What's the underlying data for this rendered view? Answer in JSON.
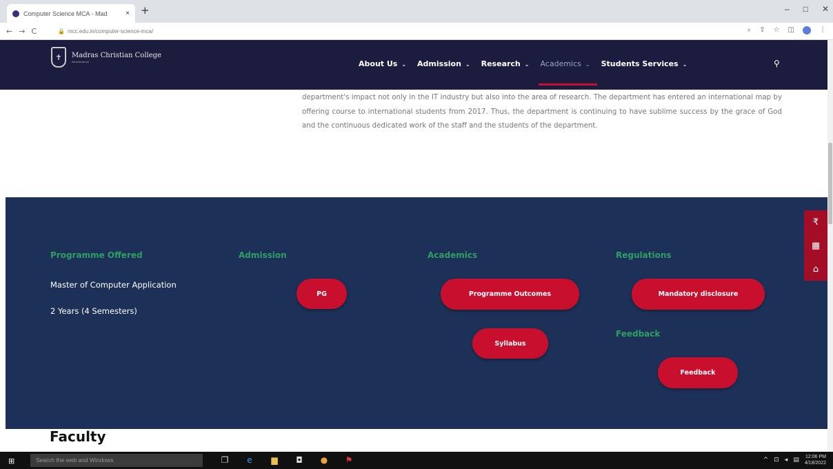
{
  "browser": {
    "tab_title": "Computer Science MCA - Mad",
    "tab_close": "×",
    "new_tab": "+",
    "window_controls": [
      "–",
      "□",
      "✕"
    ],
    "url": "mcc.edu.in/computer-science-mca/"
  },
  "header": {
    "logo_text": "Madras Christian College",
    "logo_subtext": "Autonomous",
    "nav": [
      {
        "label": "About Us"
      },
      {
        "label": "Admission"
      },
      {
        "label": "Research"
      },
      {
        "label": "Academics"
      },
      {
        "label": "Students Services"
      }
    ],
    "active_nav": "Academics"
  },
  "body_text": "department's impact not only in the IT industry but also into the area of research. The department has entered an international map by offering course to international students from 2017. Thus, the department is continuing to have sublime success by the grace of God and the continuous dedicated work of the staff and the students of the department.",
  "info": {
    "programme_heading": "Programme Offered",
    "programme_name": "Master of Computer Application",
    "programme_duration": "2 Years (4 Semesters)",
    "admission_heading": "Admission",
    "admission_button": "PG",
    "academics_heading": "Academics",
    "outcomes_button": "Programme Outcomes",
    "syllabus_button": "Syllabus",
    "regulations_heading": "Regulations",
    "disclosure_button": "Mandatory disclosure",
    "feedback_heading": "Feedback",
    "feedback_button": "Feedback"
  },
  "side_icons": [
    "rupee-icon",
    "film-icon",
    "home-icon"
  ],
  "faculty_heading": "Faculty",
  "taskbar": {
    "search_placeholder": "Search the web and Windows",
    "time": "12:06 PM",
    "date": "4/18/2022"
  },
  "colors": {
    "header_bg": "#1c1d3e",
    "section_bg": "#1d3158",
    "accent_red": "#c8102e",
    "heading_green": "#2e9e64"
  }
}
